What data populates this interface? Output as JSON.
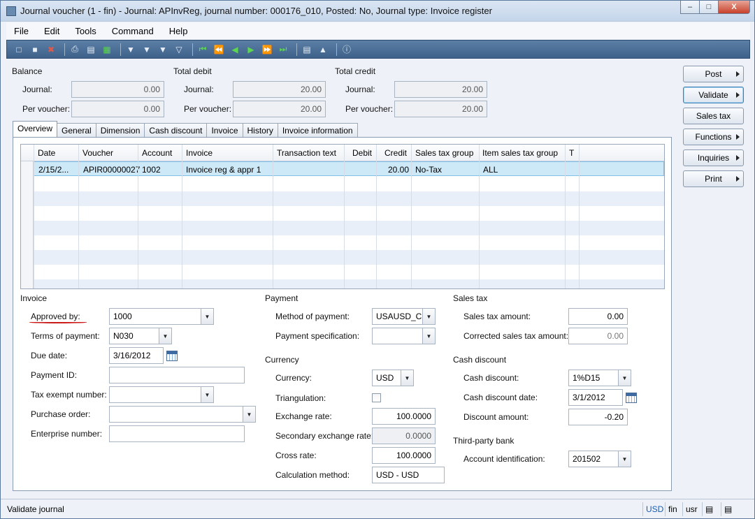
{
  "window": {
    "title": "Journal voucher (1 - fin) - Journal: APInvReg, journal number: 000176_010, Posted: No, Journal type: Invoice register",
    "minimize": "–",
    "maximize": "□",
    "close": "X"
  },
  "menu": [
    "File",
    "Edit",
    "Tools",
    "Command",
    "Help"
  ],
  "toolbar": {
    "icons": [
      "new-icon",
      "save-icon",
      "delete-icon",
      "print-icon",
      "print-preview-icon",
      "export-excel-icon",
      "filter-icon",
      "filter-by-selection-icon",
      "advanced-filter-icon",
      "remove-filter-icon",
      "first-record-icon",
      "previous-page-icon",
      "previous-record-icon",
      "next-record-icon",
      "next-page-icon",
      "last-record-icon",
      "document-handling-icon",
      "alert-icon",
      "help-icon"
    ]
  },
  "totals": {
    "balance": {
      "title": "Balance",
      "journal_label": "Journal:",
      "journal": "0.00",
      "voucher_label": "Per voucher:",
      "voucher": "0.00"
    },
    "debit": {
      "title": "Total debit",
      "journal_label": "Journal:",
      "journal": "20.00",
      "voucher_label": "Per voucher:",
      "voucher": "20.00"
    },
    "credit": {
      "title": "Total credit",
      "journal_label": "Journal:",
      "journal": "20.00",
      "voucher_label": "Per voucher:",
      "voucher": "20.00"
    }
  },
  "side_buttons": {
    "post": "Post",
    "validate": "Validate",
    "sales_tax": "Sales tax",
    "functions": "Functions",
    "inquiries": "Inquiries",
    "print": "Print"
  },
  "tabs": [
    "Overview",
    "General",
    "Dimension",
    "Cash discount",
    "Invoice",
    "History",
    "Invoice information"
  ],
  "grid": {
    "headers": {
      "date": "Date",
      "voucher": "Voucher",
      "account": "Account",
      "invoice": "Invoice",
      "transaction_text": "Transaction text",
      "debit": "Debit",
      "credit": "Credit",
      "sales_tax_group": "Sales tax group",
      "item_sales_tax_group": "Item sales tax group",
      "t": "T"
    },
    "rows": [
      {
        "date": "2/15/2...",
        "voucher": "APIR00000027",
        "account": "1002",
        "invoice": "Invoice reg & appr 1",
        "transaction_text": "",
        "debit": "",
        "credit": "20.00",
        "sales_tax_group": "No-Tax",
        "item_sales_tax_group": "ALL",
        "t": ""
      }
    ]
  },
  "invoice": {
    "title": "Invoice",
    "approved_by_label": "Approved by:",
    "approved_by": "1000",
    "terms_label": "Terms of payment:",
    "terms": "N030",
    "due_date_label": "Due date:",
    "due_date": "3/16/2012",
    "payment_id_label": "Payment ID:",
    "payment_id": "",
    "tax_exempt_label": "Tax exempt number:",
    "tax_exempt": "",
    "purchase_order_label": "Purchase order:",
    "purchase_order": "",
    "enterprise_label": "Enterprise number:",
    "enterprise": ""
  },
  "payment": {
    "title": "Payment",
    "method_label": "Method of payment:",
    "method": "USAUSD_CH",
    "spec_label": "Payment specification:",
    "spec": ""
  },
  "currency": {
    "title": "Currency",
    "currency_label": "Currency:",
    "currency": "USD",
    "triangulation_label": "Triangulation:",
    "triangulation": false,
    "exchange_rate_label": "Exchange rate:",
    "exchange_rate": "100.0000",
    "secondary_rate_label": "Secondary exchange rate:",
    "secondary_rate": "0.0000",
    "cross_rate_label": "Cross rate:",
    "cross_rate": "100.0000",
    "calc_method_label": "Calculation method:",
    "calc_method": "USD - USD"
  },
  "sales_tax": {
    "title": "Sales tax",
    "amount_label": "Sales tax amount:",
    "amount": "0.00",
    "corrected_label": "Corrected sales tax amount:",
    "corrected": "0.00"
  },
  "cash_discount": {
    "title": "Cash discount",
    "discount_label": "Cash discount:",
    "discount": "1%D15",
    "date_label": "Cash discount date:",
    "date": "3/1/2012",
    "amount_label": "Discount amount:",
    "amount": "-0.20"
  },
  "third_party_bank": {
    "title": "Third-party bank",
    "account_label": "Account identification:",
    "account": "201502"
  },
  "status_bar": {
    "message": "Validate journal",
    "currency": "USD",
    "company": "fin",
    "layer": "usr"
  },
  "colors": {
    "toolbar": "#3d6189",
    "selected_row": "#cde8f7",
    "alt_row": "#e8eff8",
    "annotation": "#cc1b1b"
  }
}
